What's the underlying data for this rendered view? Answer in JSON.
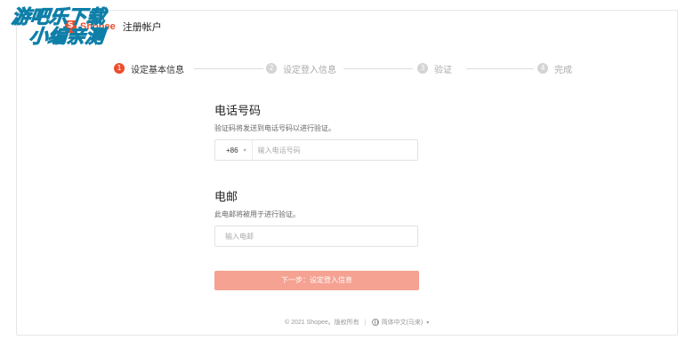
{
  "watermark": {
    "line1": "游吧乐下载",
    "line2": "小编亲测"
  },
  "header": {
    "logo_text": "Shopee",
    "title": "注册帐户",
    "logo_icon": "shopee-bag-icon"
  },
  "stepper": {
    "steps": [
      {
        "number": "1",
        "label": "设定基本信息",
        "active": true
      },
      {
        "number": "2",
        "label": "设定登入信息",
        "active": false
      },
      {
        "number": "3",
        "label": "验证",
        "active": false
      },
      {
        "number": "4",
        "label": "完成",
        "active": false
      }
    ]
  },
  "phone": {
    "title": "电话号码",
    "hint": "验证码将发送到电话号码以进行验证。",
    "country_code": "+86",
    "placeholder": "输入电话号码",
    "value": ""
  },
  "email": {
    "title": "电邮",
    "hint": "此电邮将被用于进行验证。",
    "placeholder": "输入电邮",
    "value": ""
  },
  "next_button": {
    "label": "下一步：设定登入信息"
  },
  "footer": {
    "copyright": "© 2021 Shopee。版权所有",
    "language": "简体中文(马来)"
  },
  "colors": {
    "brand": "#ee4d2d",
    "button_disabled": "#f5a293",
    "step_inactive": "#d4d4d4"
  }
}
